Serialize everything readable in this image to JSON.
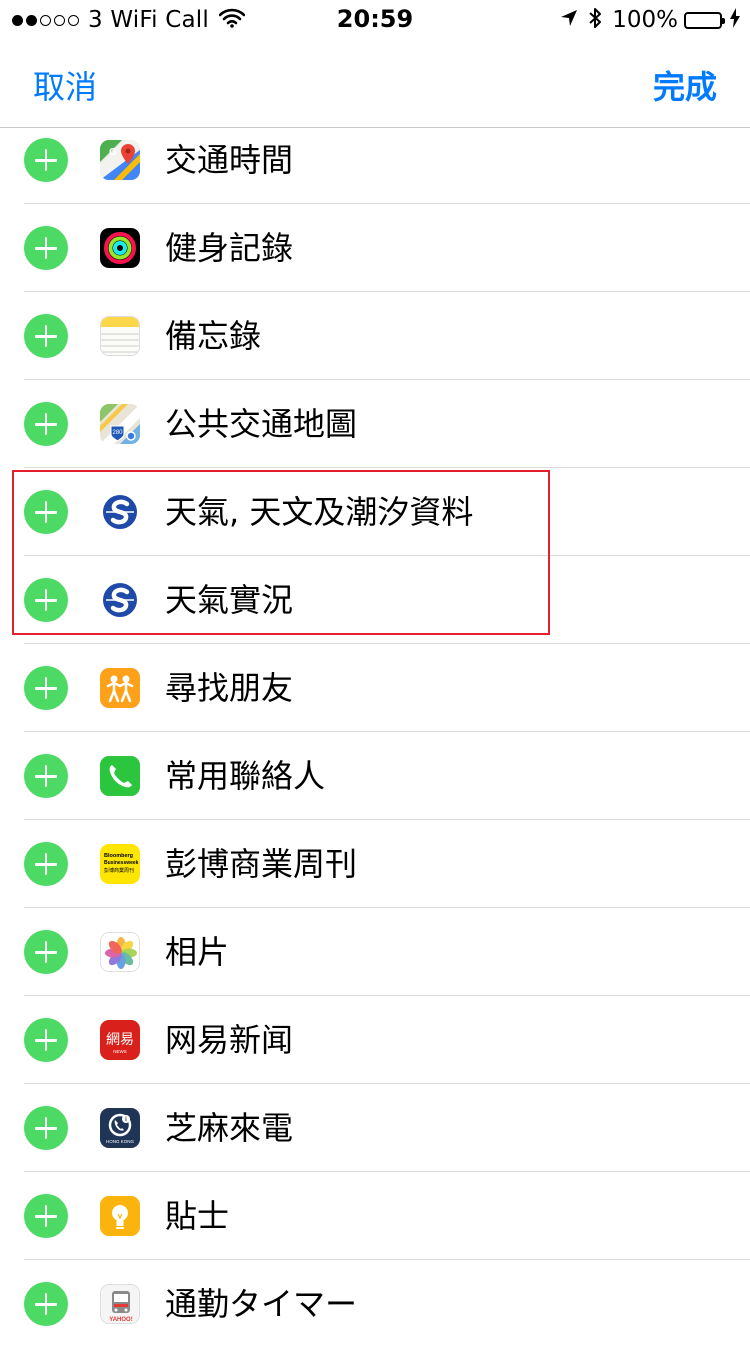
{
  "status_bar": {
    "carrier": "3 WiFi Call",
    "time": "20:59",
    "battery_percent": "100%",
    "signal_bars_filled": 2,
    "signal_bars_total": 5
  },
  "nav": {
    "cancel_label": "取消",
    "done_label": "完成"
  },
  "rows": [
    {
      "label": "交通時間",
      "icon": "google-maps-icon"
    },
    {
      "label": "健身記錄",
      "icon": "activity-icon"
    },
    {
      "label": "備忘錄",
      "icon": "notes-icon"
    },
    {
      "label": "公共交通地圖",
      "icon": "transit-map-icon"
    },
    {
      "label": "天氣, 天文及潮汐資料",
      "icon": "hko-weather-icon"
    },
    {
      "label": "天氣實況",
      "icon": "hko-weather-icon"
    },
    {
      "label": "尋找朋友",
      "icon": "find-friends-icon"
    },
    {
      "label": "常用聯絡人",
      "icon": "phone-icon"
    },
    {
      "label": "彭博商業周刊",
      "icon": "bloomberg-icon"
    },
    {
      "label": "相片",
      "icon": "photos-icon"
    },
    {
      "label": "网易新闻",
      "icon": "netease-news-icon"
    },
    {
      "label": "芝麻來電",
      "icon": "caller-id-icon"
    },
    {
      "label": "貼士",
      "icon": "tips-icon"
    },
    {
      "label": "通勤タイマー",
      "icon": "commute-timer-icon"
    }
  ],
  "icon_labels": {
    "bloomberg_line1": "Bloomberg",
    "bloomberg_line2": "Businessweek",
    "bloomberg_line3": "彭博商業周刊",
    "netease_glyphs": "網易",
    "netease_sub": "NEWS",
    "caller_id_sub": "HONG KONG",
    "transit_shield": "280",
    "commute_brand": "YAHOO!"
  },
  "colors": {
    "accent": "#007aff",
    "add_button": "#4cd964",
    "highlight": "#e4202a"
  }
}
